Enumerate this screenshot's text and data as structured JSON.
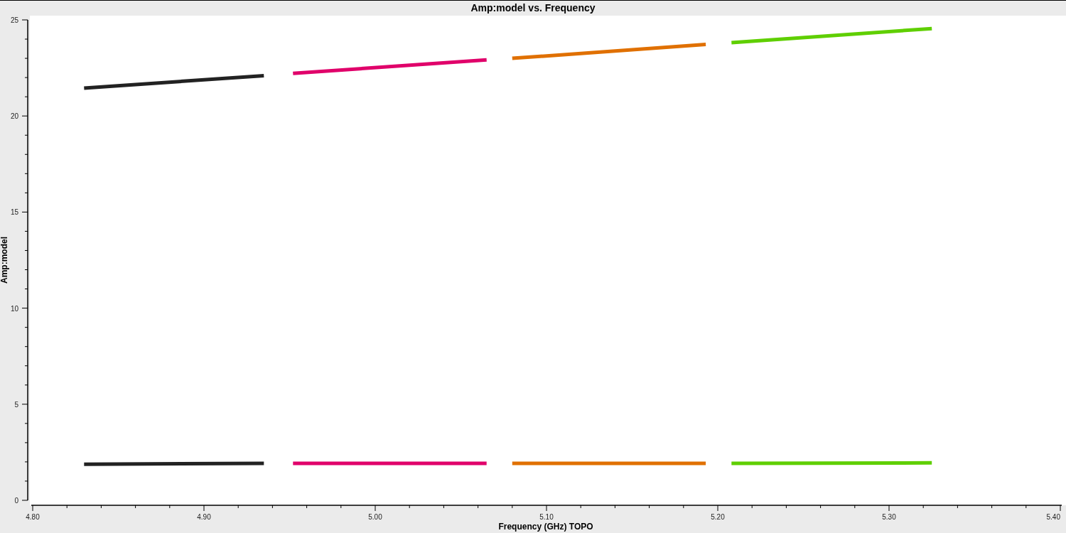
{
  "chart_data": {
    "type": "line",
    "title": "Amp:model vs. Frequency",
    "xlabel": "Frequency (GHz) TOPO",
    "ylabel": "Amp:model",
    "x": [
      4.83,
      4.935,
      4.952,
      5.065,
      5.08,
      5.193,
      5.208,
      5.325
    ],
    "series": [
      {
        "color": "#222222",
        "values": [
          21.45,
          22.1,
          null,
          null,
          null,
          null,
          null,
          null
        ]
      },
      {
        "color": "#222222",
        "values": [
          1.88,
          1.92,
          null,
          null,
          null,
          null,
          null,
          null
        ]
      },
      {
        "color": "#e0006a",
        "values": [
          null,
          null,
          22.22,
          22.92,
          null,
          null,
          null,
          null
        ]
      },
      {
        "color": "#e0006a",
        "values": [
          null,
          null,
          1.92,
          1.92,
          null,
          null,
          null,
          null
        ]
      },
      {
        "color": "#e07000",
        "values": [
          null,
          null,
          null,
          null,
          23.0,
          23.72,
          null,
          null
        ]
      },
      {
        "color": "#e07000",
        "values": [
          null,
          null,
          null,
          null,
          1.92,
          1.92,
          null,
          null
        ]
      },
      {
        "color": "#5fcf00",
        "values": [
          null,
          null,
          null,
          null,
          null,
          null,
          23.82,
          24.55
        ]
      },
      {
        "color": "#5fcf00",
        "values": [
          null,
          null,
          null,
          null,
          null,
          null,
          1.92,
          1.95
        ]
      }
    ],
    "xlim": [
      4.8,
      5.4
    ],
    "ylim": [
      0,
      25
    ],
    "xticks": [
      {
        "value": 4.8,
        "label": "4.80"
      },
      {
        "value": 4.9,
        "label": "4.90"
      },
      {
        "value": 5.0,
        "label": "5.00"
      },
      {
        "value": 5.1,
        "label": "5.10"
      },
      {
        "value": 5.2,
        "label": "5.20"
      },
      {
        "value": 5.3,
        "label": "5.30"
      },
      {
        "value": 5.4,
        "label": "5.40"
      }
    ],
    "yticks": [
      0,
      5,
      10,
      15,
      20,
      25
    ]
  }
}
